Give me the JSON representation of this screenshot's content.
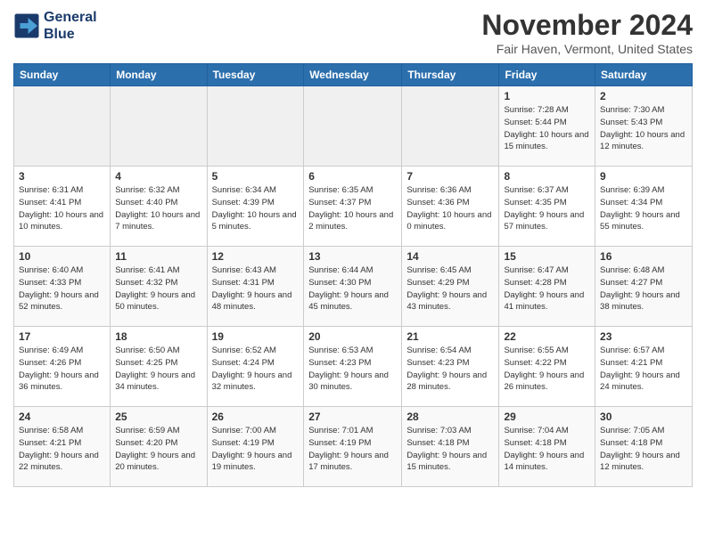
{
  "logo": {
    "text_line1": "General",
    "text_line2": "Blue"
  },
  "header": {
    "month_title": "November 2024",
    "location": "Fair Haven, Vermont, United States"
  },
  "days_of_week": [
    "Sunday",
    "Monday",
    "Tuesday",
    "Wednesday",
    "Thursday",
    "Friday",
    "Saturday"
  ],
  "weeks": [
    [
      {
        "day": "",
        "info": ""
      },
      {
        "day": "",
        "info": ""
      },
      {
        "day": "",
        "info": ""
      },
      {
        "day": "",
        "info": ""
      },
      {
        "day": "",
        "info": ""
      },
      {
        "day": "1",
        "info": "Sunrise: 7:28 AM\nSunset: 5:44 PM\nDaylight: 10 hours and 15 minutes."
      },
      {
        "day": "2",
        "info": "Sunrise: 7:30 AM\nSunset: 5:43 PM\nDaylight: 10 hours and 12 minutes."
      }
    ],
    [
      {
        "day": "3",
        "info": "Sunrise: 6:31 AM\nSunset: 4:41 PM\nDaylight: 10 hours and 10 minutes."
      },
      {
        "day": "4",
        "info": "Sunrise: 6:32 AM\nSunset: 4:40 PM\nDaylight: 10 hours and 7 minutes."
      },
      {
        "day": "5",
        "info": "Sunrise: 6:34 AM\nSunset: 4:39 PM\nDaylight: 10 hours and 5 minutes."
      },
      {
        "day": "6",
        "info": "Sunrise: 6:35 AM\nSunset: 4:37 PM\nDaylight: 10 hours and 2 minutes."
      },
      {
        "day": "7",
        "info": "Sunrise: 6:36 AM\nSunset: 4:36 PM\nDaylight: 10 hours and 0 minutes."
      },
      {
        "day": "8",
        "info": "Sunrise: 6:37 AM\nSunset: 4:35 PM\nDaylight: 9 hours and 57 minutes."
      },
      {
        "day": "9",
        "info": "Sunrise: 6:39 AM\nSunset: 4:34 PM\nDaylight: 9 hours and 55 minutes."
      }
    ],
    [
      {
        "day": "10",
        "info": "Sunrise: 6:40 AM\nSunset: 4:33 PM\nDaylight: 9 hours and 52 minutes."
      },
      {
        "day": "11",
        "info": "Sunrise: 6:41 AM\nSunset: 4:32 PM\nDaylight: 9 hours and 50 minutes."
      },
      {
        "day": "12",
        "info": "Sunrise: 6:43 AM\nSunset: 4:31 PM\nDaylight: 9 hours and 48 minutes."
      },
      {
        "day": "13",
        "info": "Sunrise: 6:44 AM\nSunset: 4:30 PM\nDaylight: 9 hours and 45 minutes."
      },
      {
        "day": "14",
        "info": "Sunrise: 6:45 AM\nSunset: 4:29 PM\nDaylight: 9 hours and 43 minutes."
      },
      {
        "day": "15",
        "info": "Sunrise: 6:47 AM\nSunset: 4:28 PM\nDaylight: 9 hours and 41 minutes."
      },
      {
        "day": "16",
        "info": "Sunrise: 6:48 AM\nSunset: 4:27 PM\nDaylight: 9 hours and 38 minutes."
      }
    ],
    [
      {
        "day": "17",
        "info": "Sunrise: 6:49 AM\nSunset: 4:26 PM\nDaylight: 9 hours and 36 minutes."
      },
      {
        "day": "18",
        "info": "Sunrise: 6:50 AM\nSunset: 4:25 PM\nDaylight: 9 hours and 34 minutes."
      },
      {
        "day": "19",
        "info": "Sunrise: 6:52 AM\nSunset: 4:24 PM\nDaylight: 9 hours and 32 minutes."
      },
      {
        "day": "20",
        "info": "Sunrise: 6:53 AM\nSunset: 4:23 PM\nDaylight: 9 hours and 30 minutes."
      },
      {
        "day": "21",
        "info": "Sunrise: 6:54 AM\nSunset: 4:23 PM\nDaylight: 9 hours and 28 minutes."
      },
      {
        "day": "22",
        "info": "Sunrise: 6:55 AM\nSunset: 4:22 PM\nDaylight: 9 hours and 26 minutes."
      },
      {
        "day": "23",
        "info": "Sunrise: 6:57 AM\nSunset: 4:21 PM\nDaylight: 9 hours and 24 minutes."
      }
    ],
    [
      {
        "day": "24",
        "info": "Sunrise: 6:58 AM\nSunset: 4:21 PM\nDaylight: 9 hours and 22 minutes."
      },
      {
        "day": "25",
        "info": "Sunrise: 6:59 AM\nSunset: 4:20 PM\nDaylight: 9 hours and 20 minutes."
      },
      {
        "day": "26",
        "info": "Sunrise: 7:00 AM\nSunset: 4:19 PM\nDaylight: 9 hours and 19 minutes."
      },
      {
        "day": "27",
        "info": "Sunrise: 7:01 AM\nSunset: 4:19 PM\nDaylight: 9 hours and 17 minutes."
      },
      {
        "day": "28",
        "info": "Sunrise: 7:03 AM\nSunset: 4:18 PM\nDaylight: 9 hours and 15 minutes."
      },
      {
        "day": "29",
        "info": "Sunrise: 7:04 AM\nSunset: 4:18 PM\nDaylight: 9 hours and 14 minutes."
      },
      {
        "day": "30",
        "info": "Sunrise: 7:05 AM\nSunset: 4:18 PM\nDaylight: 9 hours and 12 minutes."
      }
    ]
  ]
}
